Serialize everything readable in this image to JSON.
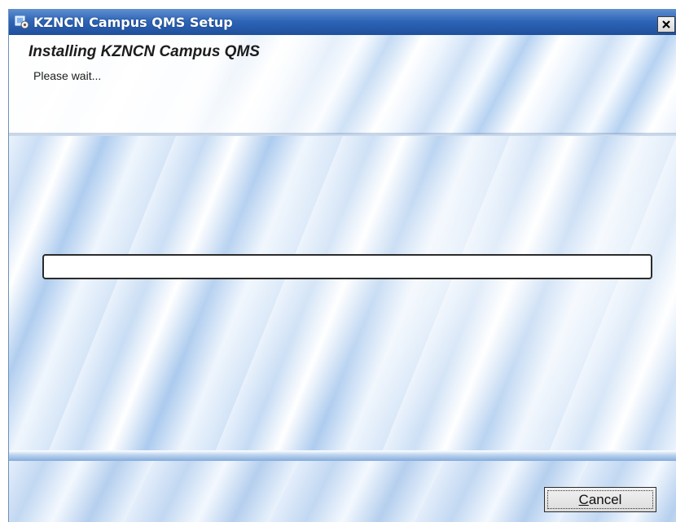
{
  "window": {
    "title": "KZNCN Campus QMS Setup",
    "close_label": "×"
  },
  "header": {
    "title": "Installing KZNCN Campus QMS",
    "subtitle": "Please wait..."
  },
  "progress": {
    "value": 0
  },
  "footer": {
    "cancel_mnemonic": "C",
    "cancel_rest": "ancel"
  },
  "icons": {
    "app": "installer-icon",
    "close": "close-icon"
  }
}
